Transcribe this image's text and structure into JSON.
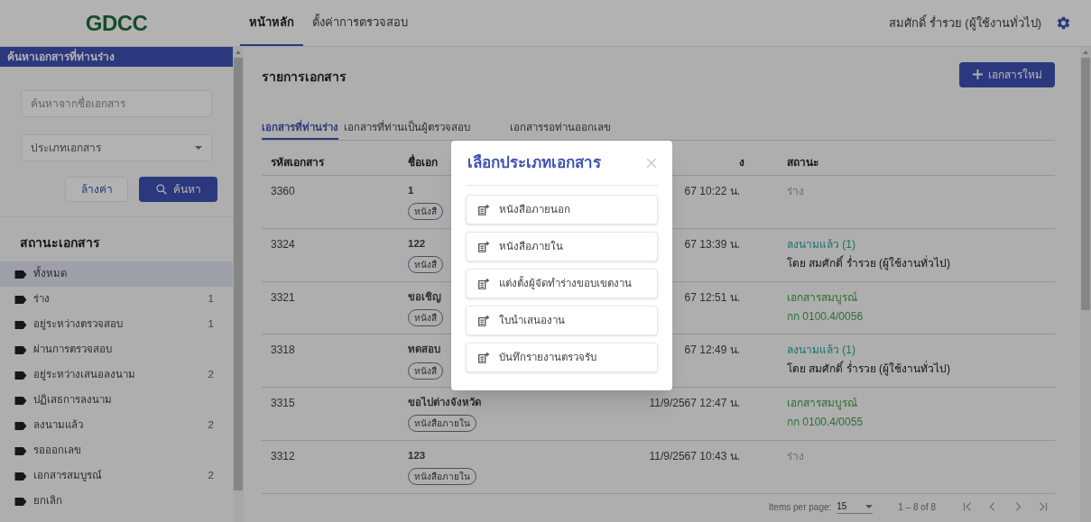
{
  "header": {
    "logo": "GDCC",
    "nav": [
      {
        "label": "หน้าหลัก",
        "selected": true
      },
      {
        "label": "ตั้งค่าการตรวจสอบ",
        "selected": false
      }
    ],
    "user": "สมศักดิ์ ร่ำรวย (ผู้ใช้งานทั่วไป)"
  },
  "sidebar": {
    "title": "ค้นหาเอกสารที่ท่านร่าง",
    "search_placeholder": "ค้นหาจากชื่อเอกสาร",
    "type_placeholder": "ประเภทเอกสาร",
    "clear_button": "ล้างค่า",
    "search_button": "ค้นหา",
    "status_heading": "สถานะเอกสาร",
    "items": [
      {
        "label": "ทั้งหมด",
        "selected": true
      },
      {
        "label": "ร่าง",
        "count": "1",
        "selected": false
      },
      {
        "label": "อยู่ระหว่างตรวจสอบ",
        "count": "1",
        "selected": false
      },
      {
        "label": "ผ่านการตรวจสอบ",
        "selected": false
      },
      {
        "label": "อยู่ระหว่างเสนอลงนาม",
        "count": "2",
        "selected": false
      },
      {
        "label": "ปฏิเสธการลงนาม",
        "selected": false
      },
      {
        "label": "ลงนามแล้ว",
        "count": "2",
        "selected": false
      },
      {
        "label": "รอออกเลข",
        "selected": false
      },
      {
        "label": "เอกสารสมบูรณ์",
        "count": "2",
        "selected": false
      },
      {
        "label": "ยกเลิก",
        "selected": false
      }
    ]
  },
  "main": {
    "title": "รายการเอกสาร",
    "new_button": "เอกสารใหม่",
    "tabs": [
      {
        "label": "เอกสารที่ท่านร่าง",
        "selected": true
      },
      {
        "label": "เอกสารที่ท่านเป็นผู้ตรวจสอบ",
        "selected": false
      },
      {
        "label": "เอกสารรอท่านออกเลข",
        "selected": false
      }
    ],
    "table": {
      "columns": [
        "รหัสเอกสาร",
        "ชื่อเอก",
        "ง",
        "สถานะ"
      ],
      "rows": [
        {
          "id": "3360",
          "name": "1",
          "tag": "หนังสื",
          "date": "67 10:22 น.",
          "status": {
            "kind": "draft",
            "label": "ร่าง"
          }
        },
        {
          "id": "3324",
          "name": "122",
          "tag": "หนังสื",
          "date": "67 13:39 น.",
          "status": {
            "kind": "signed",
            "label": "ลงนามแล้ว (1)",
            "detail": "โดย สมศักดิ์ ร่ำรวย (ผู้ใช้งานทั่วไป)"
          }
        },
        {
          "id": "3321",
          "name": "ขอเชิญ",
          "tag": "หนังสื",
          "date": "67 12:51 น.",
          "status": {
            "kind": "complete",
            "label": "เอกสารสมบูรณ์",
            "detail": "กก 0100.4/0056"
          }
        },
        {
          "id": "3318",
          "name": "ทดสอบ",
          "tag": "หนังสื",
          "date": "67 12:49 น.",
          "status": {
            "kind": "signed",
            "label": "ลงนามแล้ว (1)",
            "detail": "โดย สมศักดิ์ ร่ำรวย (ผู้ใช้งานทั่วไป)"
          }
        },
        {
          "id": "3315",
          "name": "ขอไปต่างจังหวัด",
          "tag": "หนังสือภายใน",
          "date": "11/9/2567 12:47 น.",
          "status": {
            "kind": "complete",
            "label": "เอกสารสมบูรณ์",
            "detail": "กก 0100.4/0055"
          }
        },
        {
          "id": "3312",
          "name": "123",
          "tag": "หนังสือภายใน",
          "date": "11/9/2567 10:43 น.",
          "status": {
            "kind": "draft",
            "label": "ร่าง"
          }
        }
      ]
    },
    "pagination": {
      "label": "Items per page:",
      "page_size": "15",
      "range": "1 – 8 of 8"
    }
  },
  "dialog": {
    "title": "เลือกประเภทเอกสาร",
    "options": [
      "หนังสือภายนอก",
      "หนังสือภายใน",
      "แต่งตั้งผู้จัดทำร่างขอบเขตงาน",
      "ใบนำเสนองาน",
      "บันทึกรายงานตรวจรับ"
    ]
  }
}
